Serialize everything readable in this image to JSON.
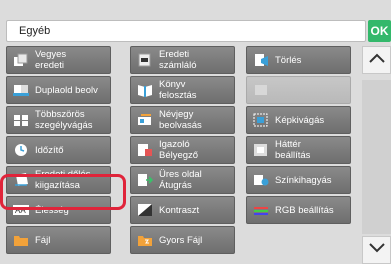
{
  "header": {
    "title": "Egyéb"
  },
  "ok_label": "OK",
  "buttons": [
    {
      "line1": "Vegyes",
      "line2": "eredeti",
      "icon": "mixed-originals-icon",
      "enabled": true
    },
    {
      "line1": "Eredeti",
      "line2": "számláló",
      "icon": "original-counter-icon",
      "enabled": true
    },
    {
      "line1": "Törlés",
      "line2": "",
      "icon": "erase-icon",
      "enabled": true
    },
    {
      "line1": "Duplaold beolv",
      "line2": "",
      "icon": "dual-page-scan-icon",
      "enabled": true
    },
    {
      "line1": "Könyv",
      "line2": "felosztás",
      "icon": "book-divide-icon",
      "enabled": true
    },
    {
      "line1": "",
      "line2": "",
      "icon": "disabled-function-icon",
      "enabled": false
    },
    {
      "line1": "Többszörös",
      "line2": "szegélyvágás",
      "icon": "multi-crop-icon",
      "enabled": true
    },
    {
      "line1": "Névjegy",
      "line2": "beolvasás",
      "icon": "business-card-icon",
      "enabled": true
    },
    {
      "line1": "Képkivágás",
      "line2": "",
      "icon": "image-crop-icon",
      "enabled": true
    },
    {
      "line1": "Időzítő",
      "line2": "",
      "icon": "timer-icon",
      "enabled": true
    },
    {
      "line1": "Igazoló",
      "line2": "Bélyegző",
      "icon": "verification-stamp-icon",
      "enabled": true
    },
    {
      "line1": "Háttér",
      "line2": "beállítás",
      "icon": "background-adjust-icon",
      "enabled": true
    },
    {
      "line1": "Eredeti dőlés",
      "line2": "kiigazítása",
      "icon": "skew-adjust-icon",
      "enabled": true
    },
    {
      "line1": "Üres oldal",
      "line2": "Átugrás",
      "icon": "blank-page-skip-icon",
      "enabled": true
    },
    {
      "line1": "Színkihagyás",
      "line2": "",
      "icon": "color-dropout-icon",
      "enabled": true
    },
    {
      "line1": "Élesség",
      "line2": "",
      "icon": "sharpness-icon",
      "enabled": true
    },
    {
      "line1": "Kontraszt",
      "line2": "",
      "icon": "contrast-icon",
      "enabled": true
    },
    {
      "line1": "RGB beállítás",
      "line2": "",
      "icon": "rgb-adjust-icon",
      "enabled": true
    },
    {
      "line1": "Fájl",
      "line2": "",
      "icon": "file-icon",
      "enabled": true
    },
    {
      "line1": "Gyors Fájl",
      "line2": "",
      "icon": "quick-file-icon",
      "enabled": true
    }
  ],
  "highlighted_button": "Eredeti dőlés kiigazítása",
  "colors": {
    "ok": "#33b86b",
    "highlight": "#e0243a",
    "button": "#7a7a7a"
  }
}
